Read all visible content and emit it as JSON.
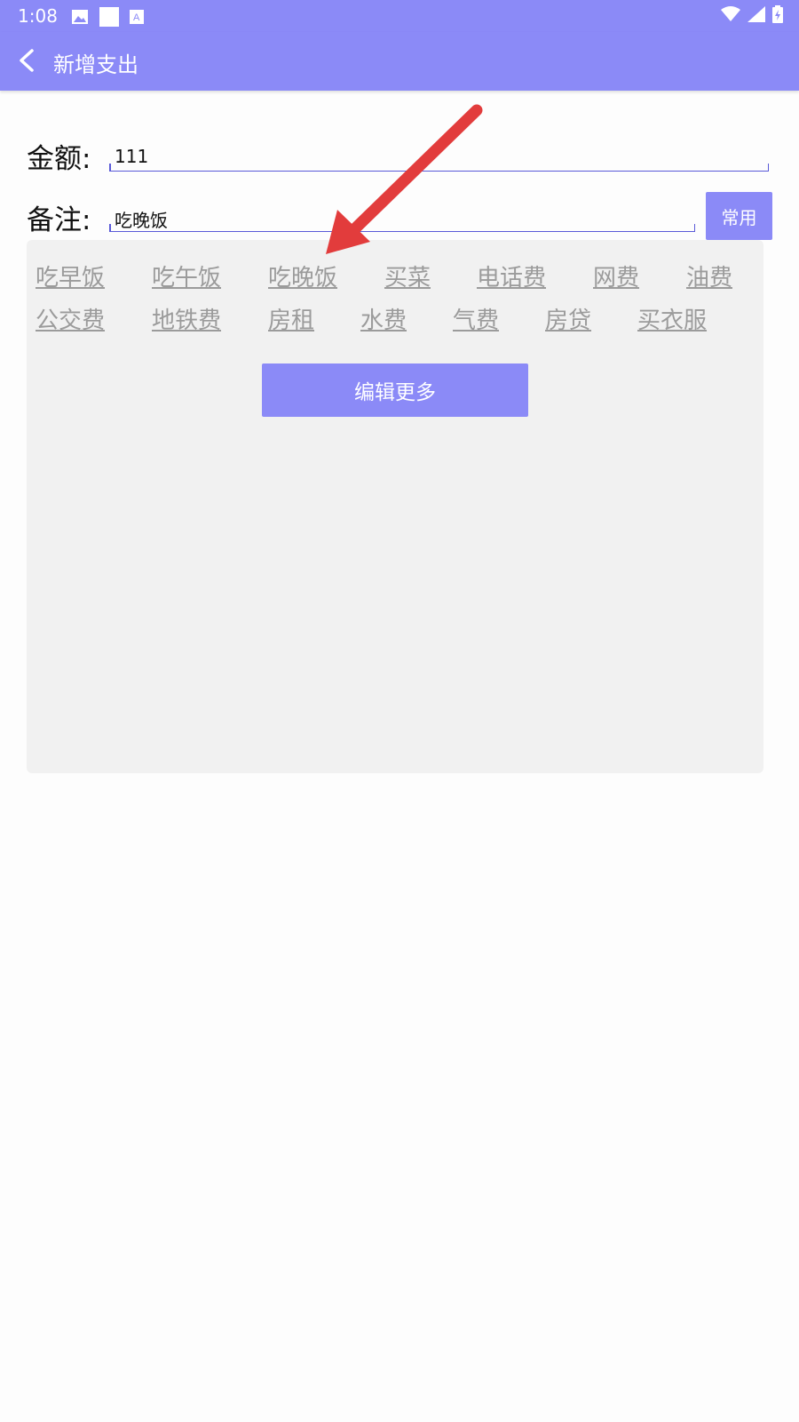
{
  "status_bar": {
    "time": "1:08",
    "left_icons": [
      "image-icon",
      "square-icon",
      "a-icon"
    ],
    "right_icons": [
      "wifi-icon",
      "signal-icon",
      "battery-icon"
    ]
  },
  "app_bar": {
    "title": "新增支出",
    "back_icon": "chevron-left-icon",
    "color": "#8b8af7"
  },
  "form": {
    "amount_label": "金额:",
    "amount_value": "111",
    "note_label": "备注:",
    "note_value": "吃晚饭",
    "common_button": "常用"
  },
  "common_notes": {
    "row1": [
      "吃早饭",
      "吃午饭",
      "吃晚饭",
      "买菜",
      "电话费",
      "网费",
      "油费"
    ],
    "row2": [
      "公交费",
      "地铁费",
      "房租",
      "水费",
      "气费",
      "房贷",
      "买衣服"
    ],
    "edit_more_button": "编辑更多"
  },
  "annotation": {
    "arrow_color": "#e23c3c",
    "points_to": "吃晚饭"
  }
}
